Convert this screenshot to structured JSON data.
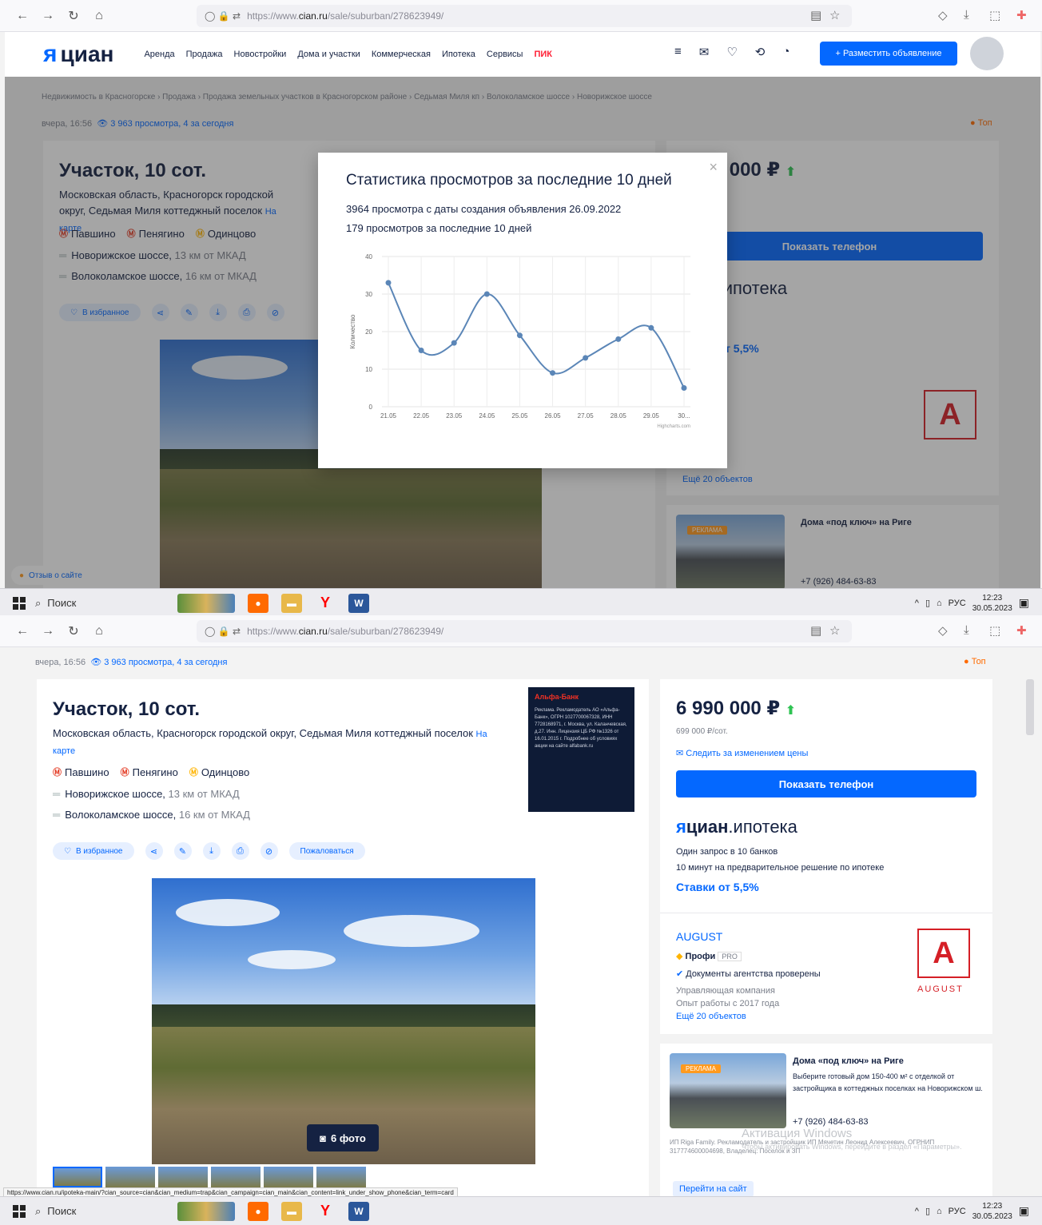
{
  "browser": {
    "url_prefix": "https://www.",
    "url_domain": "cian.ru",
    "url_path": "/sale/suburban/278623949/"
  },
  "taskbar": {
    "search_label": "Поиск",
    "lang": "РУС",
    "time": "12:23",
    "date": "30.05.2023",
    "time2": "12:23",
    "date2": "30.05.2023"
  },
  "header": {
    "logo": "циан",
    "menu": [
      "Аренда",
      "Продажа",
      "Новостройки",
      "Дома и участки",
      "Коммерческая",
      "Ипотека",
      "Сервисы",
      "ПИК"
    ],
    "post_button": "+ Разместить объявление"
  },
  "breadcrumbs": "Недвижимость в Красногорске  ›  Продажа  ›  Продажа земельных участков в Красногорском районе  ›  Седьмая Миля кп  ›  Волоколамское шоссе  ›  Новорижское шоссе",
  "listing": {
    "meta_date": "вчера, 16:56",
    "views": "3 963 просмотра, 4 за сегодня",
    "top_label": "Топ",
    "title": "Участок, 10 сот.",
    "address": "Московская область, Красногорск городской округ, Седьмая Миля коттеджный поселок",
    "map_link": "На карте",
    "metro": [
      "Павшино",
      "Пенягино",
      "Одинцово"
    ],
    "roads": [
      {
        "name": "Новорижское шоссе,",
        "dist": "13 км от МКАД"
      },
      {
        "name": "Волоколамское шоссе,",
        "dist": "16 км от МКАД"
      }
    ],
    "favorite": "В избранное",
    "complain": "Пожаловаться",
    "photo_count": "6 фото"
  },
  "promo": {
    "bank": "Альфа-Банк",
    "text": "Реклама. Рекламодатель АО «Альфа-Банк», ОГРН 1027700067328, ИНН 7728168971, г. Москва, ул. Каланчевская, д.27. Инн. Лицензия ЦБ РФ №1326 от 16.01.2015 г. Подробнее об условиях акции на сайте alfabank.ru"
  },
  "sidebar": {
    "price": "6 990 000 ₽",
    "price_per": "699 000 ₽/сот.",
    "subscribe": "Следить за изменением цены",
    "phone_button": "Показать телефон",
    "ipoteka_logo": "циан",
    "ipoteka_suffix": ".ипотека",
    "ip_line1": "Один запрос в 10 банков",
    "ip_line2": "10 минут на предварительное решение по ипотеке",
    "rates": "Ставки от 5,5%",
    "agency": "AUGUST",
    "agency_badge": "Профи",
    "agency_pro": "PRO",
    "docs_checked": "Документы агентства проверены",
    "agency_type": "Управляющая компания",
    "experience": "Опыт работы с 2017 года",
    "more_objects": "Ещё 20 объектов",
    "august_logo_text": "AUGUST"
  },
  "ad": {
    "tag": "РЕКЛАМА",
    "title": "Дома «под ключ» на Риге",
    "text": "Выберите готовый дом 150-400 м² с отделкой от застройщика в коттеджных поселках на Новорижском ш.",
    "phone": "+7 (926) 484-63-83",
    "fine": "ИП Rigа Family. Рекламодатель и застройщик ИП Мячетин Леонид Алексеевич, ОГРНИП 317774600004698, Владелец: Поселок и ЗП",
    "go": "Перейти на сайт"
  },
  "feedback": "Отзыв о сайте",
  "status_url": "https://www.cian.ru/ipoteka-main/?cian_source=cian&cian_medium=trap&cian_campaign=cian_main&cian_content=link_under_show_phone&cian_term=card",
  "windows_watermark": "Активация Windows",
  "windows_watermark_sub": "Чтобы активировать Windows, перейдите в раздел «Параметры».",
  "modal": {
    "title": "Статистика просмотров за последние 10 дней",
    "line1": "3964 просмотра с даты создания объявления 26.09.2022",
    "line2": "179 просмотров за последние 10 дней",
    "credit": "Highcharts.com"
  },
  "chart_data": {
    "type": "line",
    "categories": [
      "21.05",
      "22.05",
      "23.05",
      "24.05",
      "25.05",
      "26.05",
      "27.05",
      "28.05",
      "29.05",
      "30..."
    ],
    "series": [
      {
        "values": [
          33,
          15,
          17,
          30,
          19,
          9,
          13,
          18,
          21,
          5
        ]
      }
    ],
    "ylabel": "Количество",
    "ylim": [
      0,
      40
    ],
    "yticks": [
      "0",
      "10",
      "20",
      "30",
      "40"
    ],
    "grid": true,
    "color": "#5b86b7"
  },
  "colors": {
    "accent": "#0468ff",
    "brand_text": "#152242",
    "price_up": "#2fc353",
    "august_red": "#d51f26"
  }
}
